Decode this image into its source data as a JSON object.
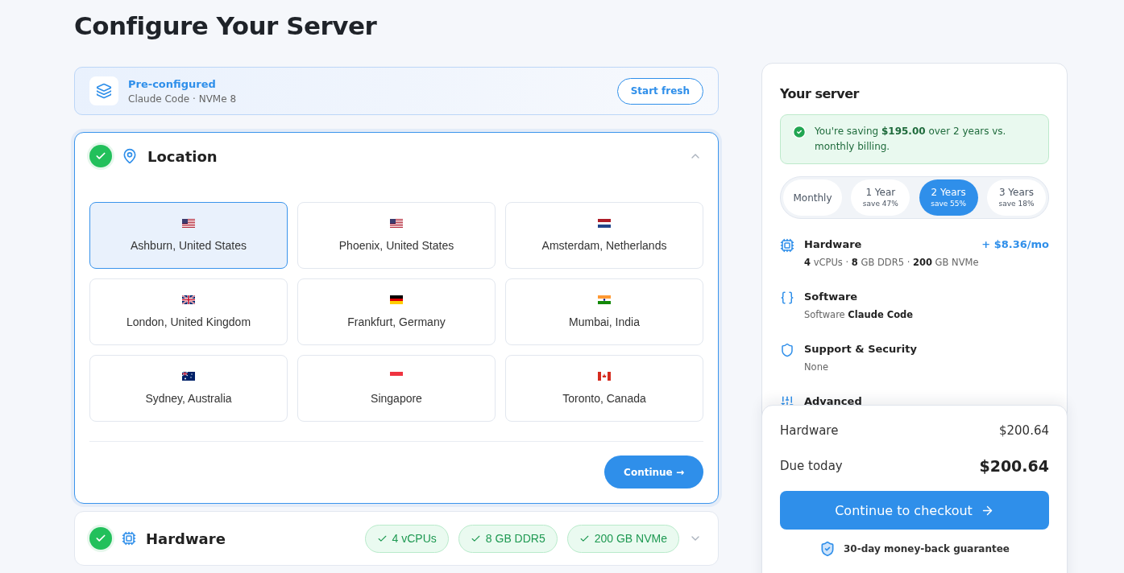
{
  "page_title": "Configure Your Server",
  "preset": {
    "title": "Pre-configured",
    "subtitle": "Claude Code · NVMe 8",
    "button": "Start fresh"
  },
  "location_step": {
    "title": "Location",
    "completed": true,
    "expanded": true,
    "locations": [
      {
        "name": "Ashburn, United States",
        "kind": "us",
        "selected": true
      },
      {
        "name": "Phoenix, United States",
        "kind": "us",
        "selected": false
      },
      {
        "name": "Amsterdam, Netherlands",
        "kind": "nl",
        "selected": false
      },
      {
        "name": "London, United Kingdom",
        "kind": "gb",
        "selected": false
      },
      {
        "name": "Frankfurt, Germany",
        "kind": "de",
        "selected": false
      },
      {
        "name": "Mumbai, India",
        "kind": "in",
        "selected": false
      },
      {
        "name": "Sydney, Australia",
        "kind": "au",
        "selected": false
      },
      {
        "name": "Singapore",
        "kind": "sg",
        "selected": false
      },
      {
        "name": "Toronto, Canada",
        "kind": "ca",
        "selected": false
      }
    ],
    "continue_button": "Continue →"
  },
  "hardware_step": {
    "title": "Hardware",
    "completed": true,
    "expanded": false,
    "chips": [
      "4 vCPUs",
      "8 GB DDR5",
      "200 GB NVMe"
    ]
  },
  "summary": {
    "title": "Your server",
    "savings": "You're saving **$195.00** over 2 years vs. monthly billing.",
    "billing": [
      {
        "label": "Monthly",
        "selected": false
      },
      {
        "label": "1 Year",
        "sub": "save 47%",
        "selected": false
      },
      {
        "label": "2 Years",
        "sub": "save 55%",
        "selected": true
      },
      {
        "label": "3 Years",
        "sub": "save 18%",
        "selected": false
      }
    ],
    "sections": [
      {
        "kind": "chip",
        "title": "Hardware",
        "price": "+ $8.36/mo",
        "detail": "**4** vCPUs · **8** GB DDR5 · **200** GB NVMe"
      },
      {
        "kind": "braces",
        "title": "Software",
        "detail": "Software **Claude Code**"
      },
      {
        "kind": "shield",
        "title": "Support & Security",
        "detail": "None"
      },
      {
        "kind": "sliders",
        "title": "Advanced"
      }
    ]
  },
  "totals": {
    "lines": [
      {
        "label": "Hardware",
        "value": "$200.64"
      }
    ],
    "due_label": "Due today",
    "due_value": "$200.64",
    "checkout_button": "Continue to checkout",
    "guarantee": "30-day money-back guarantee"
  }
}
